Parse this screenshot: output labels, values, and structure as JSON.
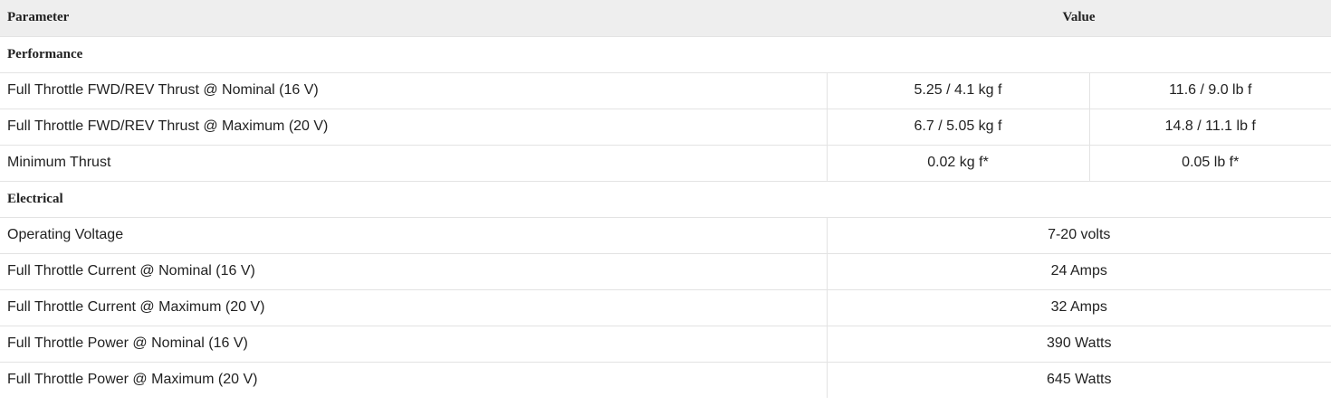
{
  "header": {
    "parameter": "Parameter",
    "value": "Value"
  },
  "performance": {
    "title": "Performance",
    "rows": [
      {
        "param": "Full Throttle FWD/REV Thrust @ Nominal (16 V)",
        "metric": "5.25 / 4.1 kg f",
        "imperial": "11.6 / 9.0 lb f"
      },
      {
        "param": "Full Throttle FWD/REV Thrust @ Maximum (20 V)",
        "metric": "6.7 / 5.05 kg f",
        "imperial": "14.8 / 11.1 lb f"
      },
      {
        "param": "Minimum Thrust",
        "metric": "0.02 kg f*",
        "imperial": "0.05 lb f*"
      }
    ]
  },
  "electrical": {
    "title": "Electrical",
    "rows": [
      {
        "param": "Operating Voltage",
        "value": "7-20 volts"
      },
      {
        "param": "Full Throttle Current @ Nominal (16 V)",
        "value": "24 Amps"
      },
      {
        "param": "Full Throttle Current @ Maximum (20 V)",
        "value": "32 Amps"
      },
      {
        "param": "Full Throttle Power @ Nominal (16 V)",
        "value": "390 Watts"
      },
      {
        "param": "Full Throttle Power @ Maximum (20 V)",
        "value": "645 Watts"
      }
    ]
  }
}
